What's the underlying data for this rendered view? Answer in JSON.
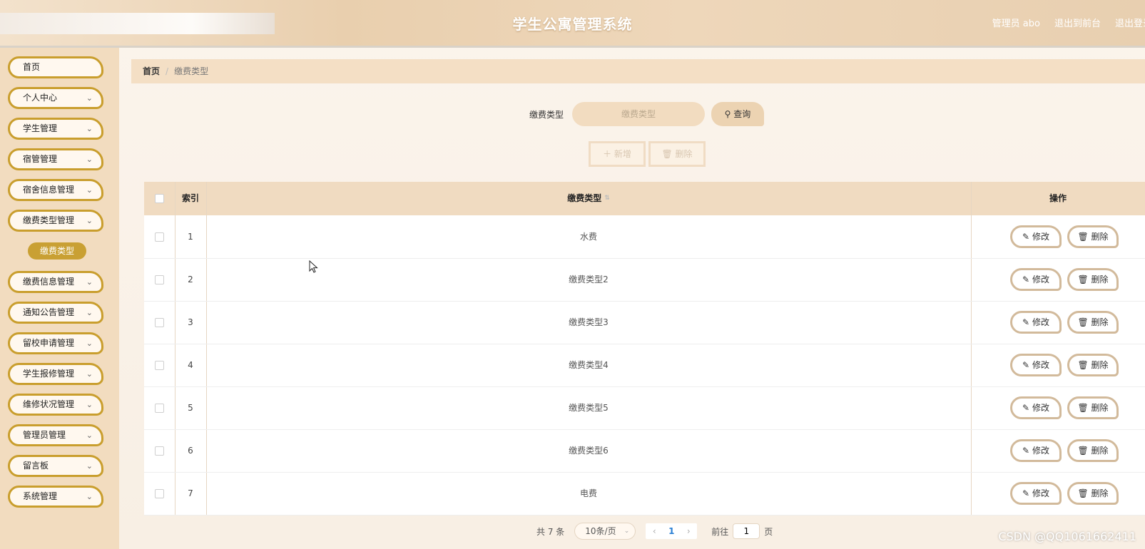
{
  "header": {
    "title": "学生公寓管理系统",
    "user": "管理员 abo",
    "to_frontend": "退出到前台",
    "logout": "退出登录"
  },
  "sidebar": {
    "items": [
      {
        "label": "首页",
        "has_children": false
      },
      {
        "label": "个人中心",
        "has_children": true
      },
      {
        "label": "学生管理",
        "has_children": true
      },
      {
        "label": "宿管管理",
        "has_children": true
      },
      {
        "label": "宿舍信息管理",
        "has_children": true
      },
      {
        "label": "缴费类型管理",
        "has_children": true
      },
      {
        "label": "缴费信息管理",
        "has_children": true
      },
      {
        "label": "通知公告管理",
        "has_children": true
      },
      {
        "label": "留校申请管理",
        "has_children": true
      },
      {
        "label": "学生报修管理",
        "has_children": true
      },
      {
        "label": "维修状况管理",
        "has_children": true
      },
      {
        "label": "管理员管理",
        "has_children": true
      },
      {
        "label": "留言板",
        "has_children": true
      },
      {
        "label": "系统管理",
        "has_children": true
      }
    ],
    "active_sub": "缴费类型"
  },
  "breadcrumb": {
    "home": "首页",
    "current": "缴费类型"
  },
  "search": {
    "label": "缴费类型",
    "placeholder": "缴费类型",
    "button": "查询"
  },
  "toolbar": {
    "add": "新增",
    "delete": "删除"
  },
  "table": {
    "headers": {
      "index": "索引",
      "type": "缴费类型",
      "ops": "操作"
    },
    "edit_label": "修改",
    "delete_label": "删除",
    "rows": [
      {
        "index": "1",
        "type": "水费"
      },
      {
        "index": "2",
        "type": "缴费类型2"
      },
      {
        "index": "3",
        "type": "缴费类型3"
      },
      {
        "index": "4",
        "type": "缴费类型4"
      },
      {
        "index": "5",
        "type": "缴费类型5"
      },
      {
        "index": "6",
        "type": "缴费类型6"
      },
      {
        "index": "7",
        "type": "电费"
      }
    ]
  },
  "pager": {
    "total": "共 7 条",
    "page_size": "10条/页",
    "current_page": "1",
    "goto_label": "前往",
    "goto_value": "1",
    "page_suffix": "页"
  },
  "watermark": "CSDN @QQ1061662411",
  "colors": {
    "accent": "#c9a033",
    "header": "#e9cfae",
    "table_head": "#f0dbc1"
  }
}
